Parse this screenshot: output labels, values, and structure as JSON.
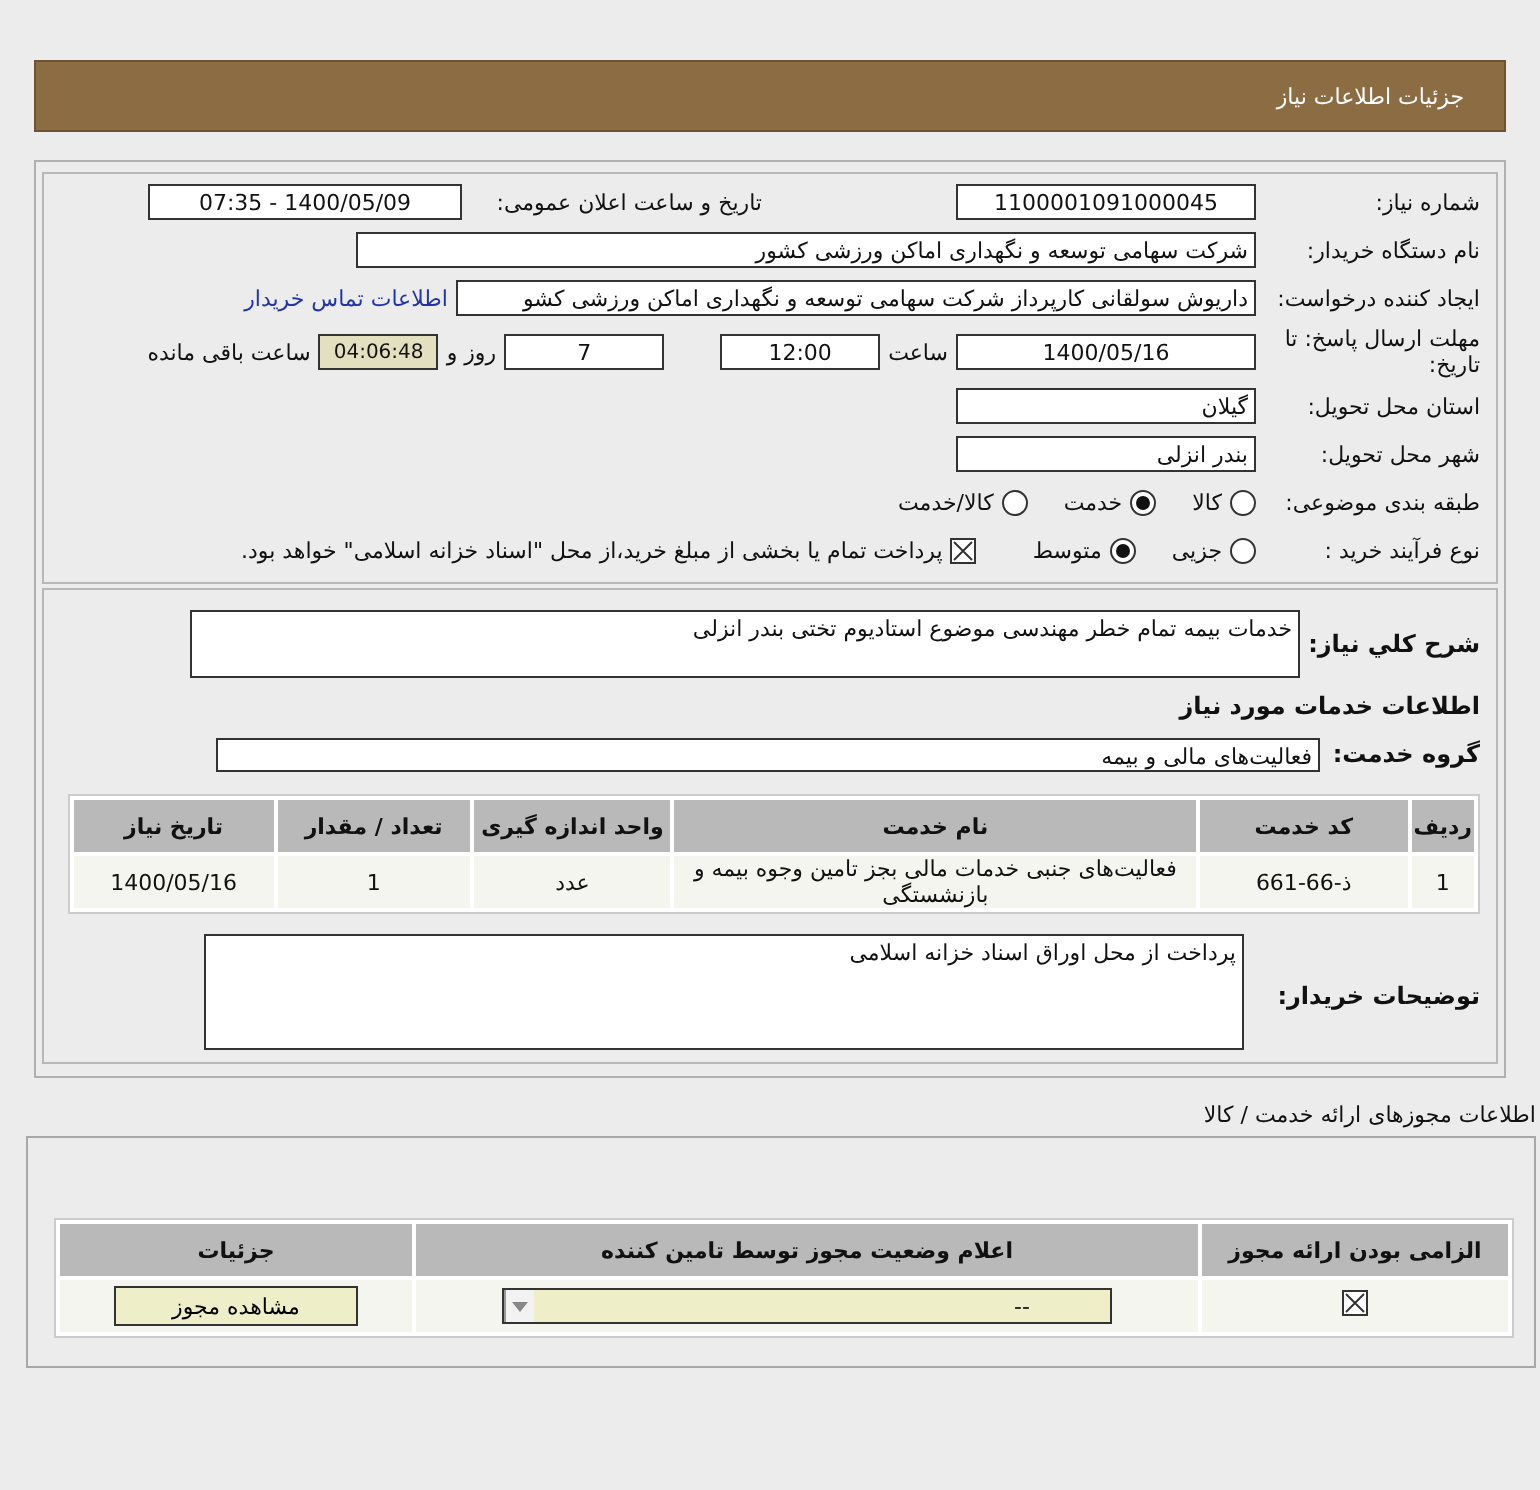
{
  "header": {
    "title": "جزئیات اطلاعات نیاز"
  },
  "need_number": {
    "label": "شماره نیاز:",
    "value": "1100001091000045"
  },
  "announce": {
    "label": "تاریخ و ساعت اعلان عمومی:",
    "value": "1400/05/09 - 07:35"
  },
  "buyer": {
    "label": "نام دستگاه خریدار:",
    "value": "شرکت سهامی توسعه و نگهداری اماکن ورزشی کشور"
  },
  "requester": {
    "label": "ایجاد کننده درخواست:",
    "value": "داریوش سولقانی کارپرداز شرکت سهامی توسعه و نگهداری اماکن ورزشی کشو",
    "link": "اطلاعات تماس خریدار"
  },
  "deadline": {
    "label": "مهلت ارسال پاسخ: تا تاریخ:",
    "date": "1400/05/16",
    "time_label": "ساعت",
    "time": "12:00",
    "days": "7",
    "days_label": "روز و",
    "remaining": "04:06:48",
    "remaining_label": "ساعت باقی مانده"
  },
  "province": {
    "label": "استان محل تحویل:",
    "value": "گیلان"
  },
  "city": {
    "label": "شهر محل تحویل:",
    "value": "بندر انزلی"
  },
  "category": {
    "label": "طبقه بندی موضوعی:",
    "options": [
      {
        "label": "کالا",
        "selected": false
      },
      {
        "label": "خدمت",
        "selected": true
      },
      {
        "label": "کالا/خدمت",
        "selected": false
      }
    ]
  },
  "process": {
    "label": "نوع فرآیند خرید :",
    "options": [
      {
        "label": "جزیی",
        "selected": false
      },
      {
        "label": "متوسط",
        "selected": true
      }
    ],
    "payment": {
      "checked": true,
      "text": "پرداخت تمام یا بخشی از مبلغ خرید،از محل \"اسناد خزانه اسلامی\" خواهد بود."
    }
  },
  "description": {
    "label": "شرح کلي نياز:",
    "value": "خدمات بیمه تمام خطر مهندسی موضوع استادیوم تختی بندر انزلی"
  },
  "services_title": "اطلاعات خدمات مورد نیاز",
  "service_group": {
    "label": "گروه خدمت:",
    "value": "فعالیت‌های مالی و بیمه"
  },
  "items_table": {
    "columns": [
      "ردیف",
      "کد خدمت",
      "نام خدمت",
      "واحد اندازه گیری",
      "تعداد / مقدار",
      "تاریخ نیاز"
    ],
    "rows": [
      [
        "1",
        "ذ-66-661",
        "فعالیت‌های جنبی خدمات مالی بجز تامین وجوه بیمه و بازنشستگی",
        "عدد",
        "1",
        "1400/05/16"
      ]
    ]
  },
  "buyer_notes": {
    "label": "توضیحات خریدار:",
    "value": "پرداخت از محل اوراق اسناد خزانه اسلامی"
  },
  "permits": {
    "title": "اطلاعات مجوزهای ارائه خدمت / کالا",
    "columns": [
      "الزامی بودن ارائه مجوز",
      "اعلام وضعیت مجوز توسط تامین کننده",
      "جزئیات"
    ],
    "rows": [
      {
        "required": true,
        "status": "--",
        "action": "مشاهده مجوز"
      }
    ]
  }
}
